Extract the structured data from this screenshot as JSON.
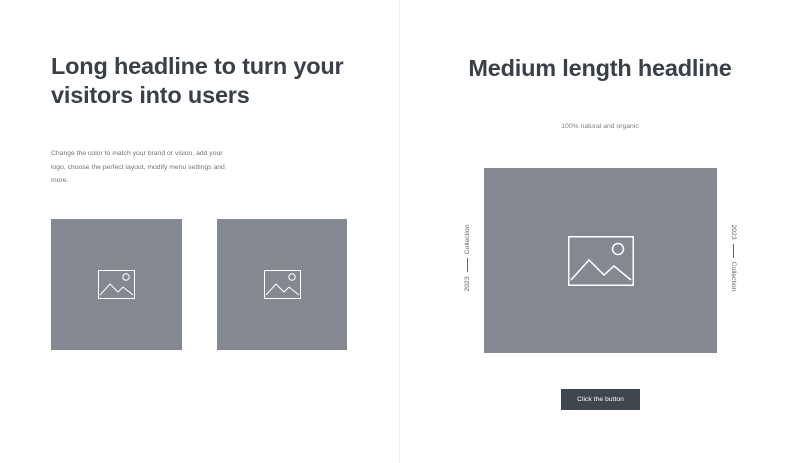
{
  "left": {
    "headline": "Long headline to turn your visitors into users",
    "body": "Change the color to match your brand or vision, add your logo, choose the perfect layout, modify menu settings and more.",
    "images": [
      {
        "icon": "image-icon"
      },
      {
        "icon": "image-icon"
      }
    ]
  },
  "right": {
    "headline": "Medium length headline",
    "tagline": "100% natural and organic",
    "image": {
      "icon": "image-icon"
    },
    "side_label": {
      "year": "2023",
      "word": "Collection"
    },
    "button_label": "Click the button"
  },
  "colors": {
    "placeholder": "#848991",
    "button": "#3f464e",
    "heading": "#3a4048",
    "body_text": "#6d747c"
  }
}
